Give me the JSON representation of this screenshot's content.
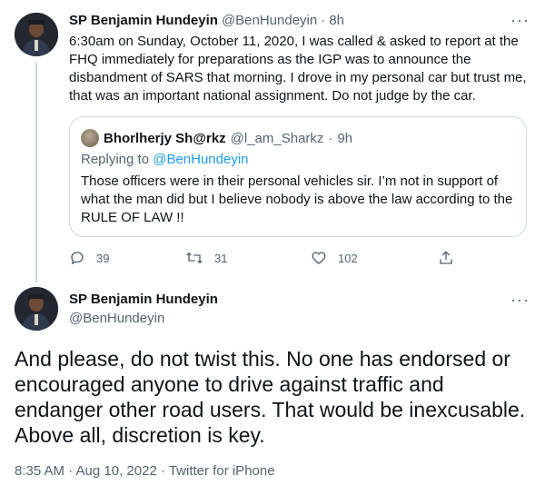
{
  "tweet1": {
    "author_name": "SP Benjamin Hundeyin",
    "author_handle": "@BenHundeyin",
    "time": "8h",
    "text": "6:30am on Sunday, October 11, 2020, I was called & asked to report at the FHQ immediately for preparations as the IGP was to announce the disbandment of SARS that morning. I drove in my personal car but trust me, that was an important national assignment. Do not judge by the car.",
    "more_label": "···",
    "quote": {
      "author_name": "Bhorlherjy Sh@rkz",
      "author_handle": "@l_am_Sharkz",
      "time": "9h",
      "replying_prefix": "Replying to ",
      "replying_to": "@BenHundeyin",
      "text": "Those officers were in their personal vehicles sir. I’m not in support of what the man did but I believe nobody is above the law according to the RULE OF LAW !!"
    },
    "actions": {
      "reply_count": "39",
      "retweet_count": "31",
      "like_count": "102"
    }
  },
  "tweet2": {
    "author_name": "SP Benjamin Hundeyin",
    "author_handle": "@BenHundeyin",
    "more_label": "···",
    "text": "And please, do not twist this. No one has endorsed or encouraged anyone to drive against traffic and endanger other road users. That would be inexcusable. Above all, discretion is key.",
    "timestamp": "8:35 AM · Aug 10, 2022 · Twitter for iPhone"
  },
  "icons": [
    "reply-icon",
    "retweet-icon",
    "like-icon",
    "share-icon",
    "more-icon"
  ],
  "colors": {
    "accent": "#1d9bf0",
    "muted": "#536471",
    "border": "#cfd9de",
    "text": "#0f1419"
  }
}
